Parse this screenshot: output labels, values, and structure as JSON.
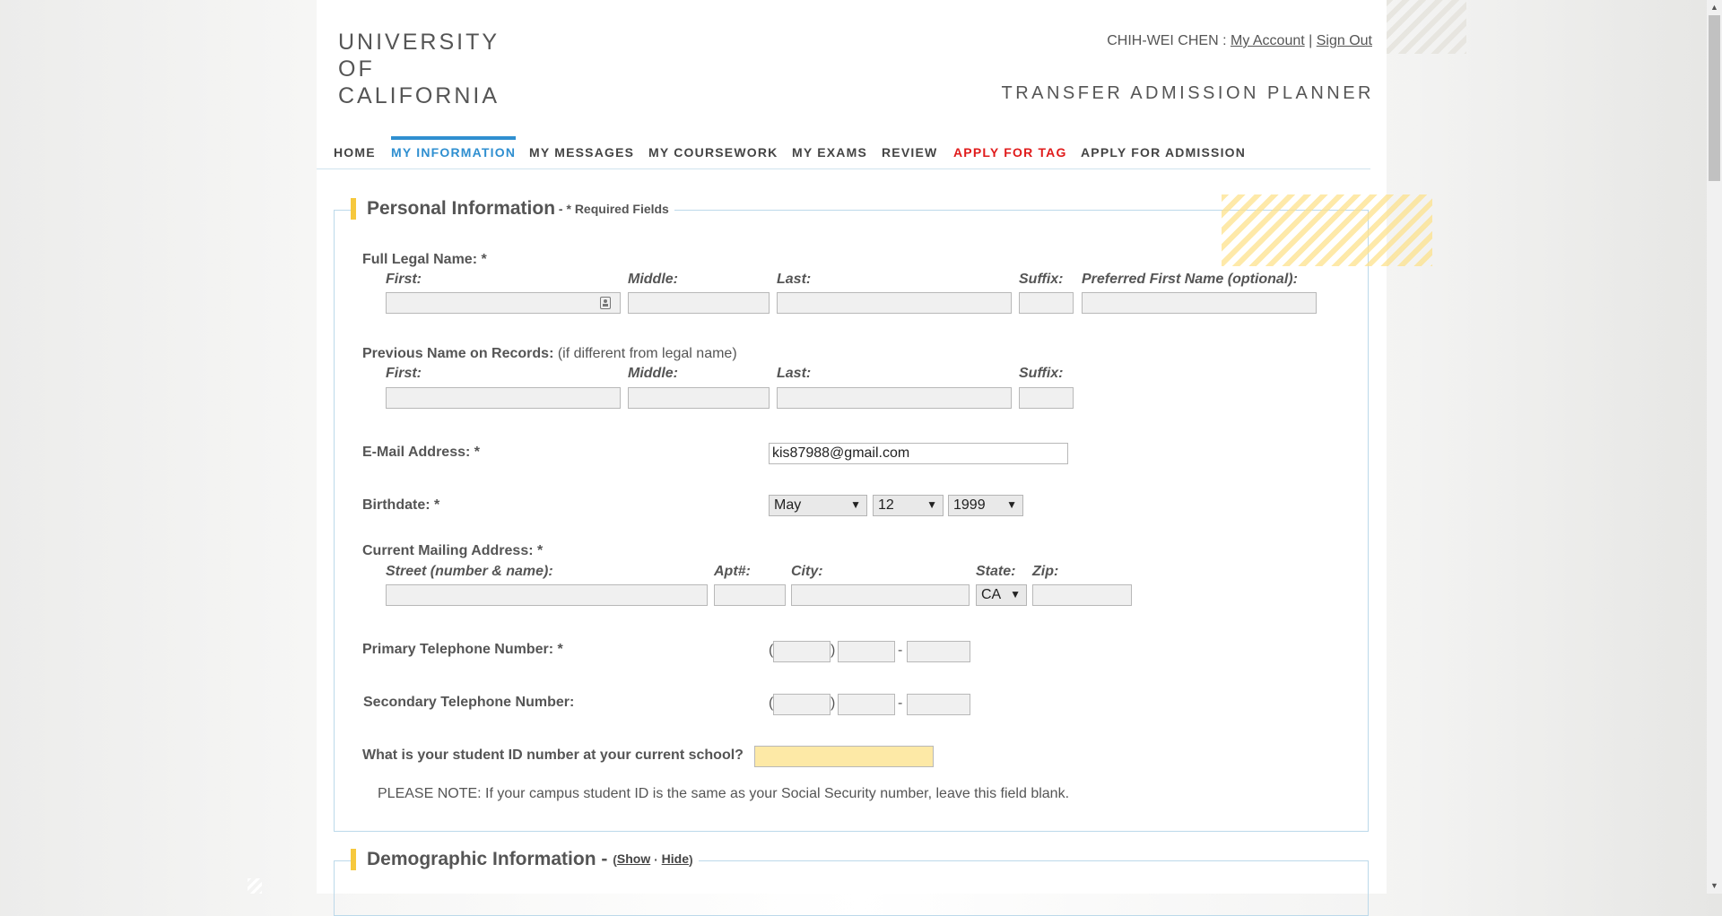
{
  "logo": {
    "lines": [
      "UNIVERSITY",
      "OF",
      "CALIFORNIA"
    ]
  },
  "account": {
    "user": "CHIH-WEI CHEN",
    "separator1": " : ",
    "my_account": "My Account",
    "separator2": " | ",
    "sign_out": "Sign Out"
  },
  "app_title": "TRANSFER ADMISSION PLANNER",
  "nav": [
    {
      "label": "HOME"
    },
    {
      "label": "MY INFORMATION",
      "active": true
    },
    {
      "label": "MY MESSAGES"
    },
    {
      "label": "MY COURSEWORK"
    },
    {
      "label": "MY EXAMS"
    },
    {
      "label": "REVIEW"
    },
    {
      "label": "APPLY FOR TAG",
      "color": "#e01b1b"
    },
    {
      "label": "APPLY FOR ADMISSION"
    }
  ],
  "personal": {
    "title": "Personal Information",
    "dash": " - ",
    "required_note": "* Required Fields",
    "full_name": {
      "label": "Full Legal Name: *",
      "first": "First:",
      "middle": "Middle:",
      "last": "Last:",
      "suffix": "Suffix:",
      "preferred": "Preferred First Name (optional):",
      "values": {
        "first": "",
        "middle": "",
        "last": "",
        "suffix": "",
        "preferred": ""
      }
    },
    "previous_name": {
      "label": "Previous Name on Records:",
      "label_note": " (if different from legal name)",
      "first": "First:",
      "middle": "Middle:",
      "last": "Last:",
      "suffix": "Suffix:"
    },
    "email": {
      "label": "E-Mail Address: *",
      "value": "kis87988@gmail.com"
    },
    "birthdate": {
      "label": "Birthdate: *",
      "month": "May",
      "day": "12",
      "year": "1999"
    },
    "address": {
      "label": "Current Mailing Address: *",
      "street": "Street (number & name):",
      "apt": "Apt#:",
      "city": "City:",
      "state": "State:",
      "zip": "Zip:",
      "state_value": "CA"
    },
    "primary_phone": {
      "label": "Primary Telephone Number: *"
    },
    "secondary_phone": {
      "label": "Secondary Telephone Number:"
    },
    "student_id": {
      "label": "What is your student ID number at your current school?",
      "value": ""
    },
    "please_note": "PLEASE NOTE: If your campus student ID is the same as your Social Security number, leave this field blank."
  },
  "demographic": {
    "title": "Demographic Information",
    "dash": " - ",
    "open_paren": "(",
    "show": "Show",
    "dot": " · ",
    "hide": "Hide",
    "close_paren": ")"
  },
  "icons": {
    "autofill": "contact-card-icon",
    "scroll_up": "arrow-up-icon",
    "scroll_down": "arrow-down-icon"
  },
  "colors": {
    "accent_blue": "#2f8fd0",
    "tag_red": "#e01b1b",
    "legend_yellow": "#f6c83d",
    "id_field": "#fde9a6"
  }
}
